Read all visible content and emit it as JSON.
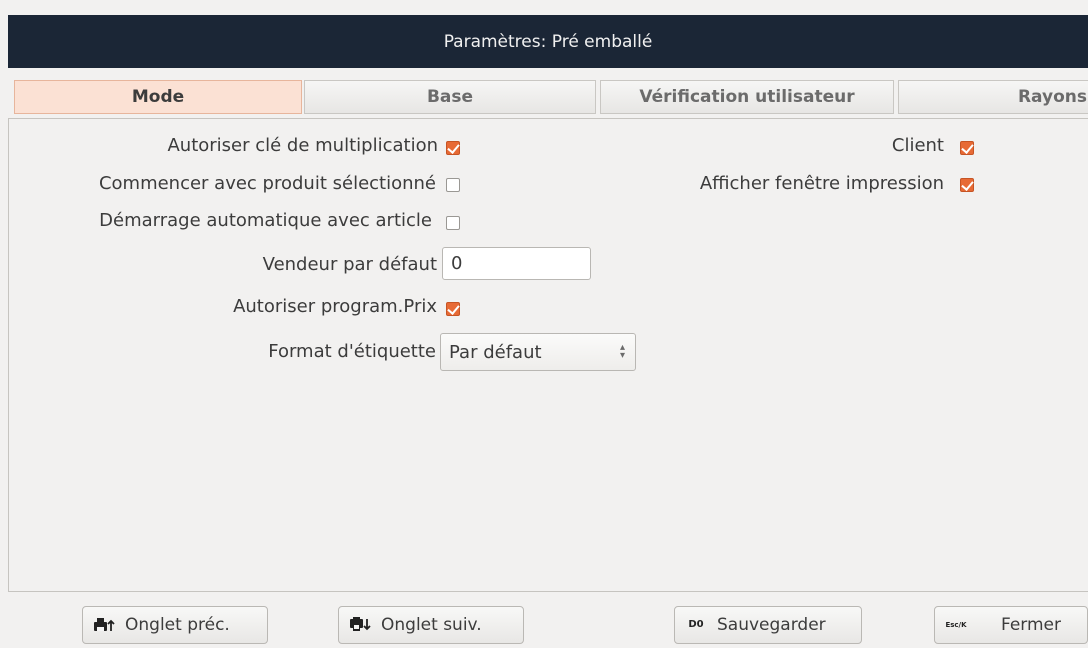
{
  "window": {
    "title": "Paramètres: Pré emballé"
  },
  "tabs": [
    {
      "label": "Mode",
      "active": true
    },
    {
      "label": "Base",
      "active": false
    },
    {
      "label": "Vérification utilisateur",
      "active": false
    },
    {
      "label": "Rayons",
      "active": false
    }
  ],
  "form": {
    "allow_multiply_key": {
      "label": "Autoriser clé de multiplication",
      "checked": true
    },
    "start_with_selected": {
      "label": "Commencer avec produit sélectionné",
      "checked": false
    },
    "auto_start_article": {
      "label": "Démarrage automatique avec article",
      "checked": false
    },
    "default_seller": {
      "label": "Vendeur par défaut",
      "value": "0"
    },
    "allow_price_program": {
      "label": "Autoriser program.Prix",
      "checked": true
    },
    "label_format": {
      "label": "Format d'étiquette",
      "value": "Par défaut"
    },
    "client": {
      "label": "Client",
      "checked": true
    },
    "show_print_window": {
      "label": "Afficher fenêtre impression",
      "checked": true
    }
  },
  "buttons": {
    "prev_tab": {
      "label": "Onglet préc.",
      "icon": "printer-up-icon"
    },
    "next_tab": {
      "label": "Onglet suiv.",
      "icon": "printer-down-icon"
    },
    "save": {
      "label": "Sauvegarder",
      "key": "D0",
      "icon": "d0-key-icon"
    },
    "close": {
      "label": "Fermer",
      "key": "Esc/K",
      "icon": "esc-key-icon"
    }
  },
  "colors": {
    "accent": "#e76a35",
    "titlebar": "#1b2636",
    "active_tab": "#fbe1d4"
  }
}
